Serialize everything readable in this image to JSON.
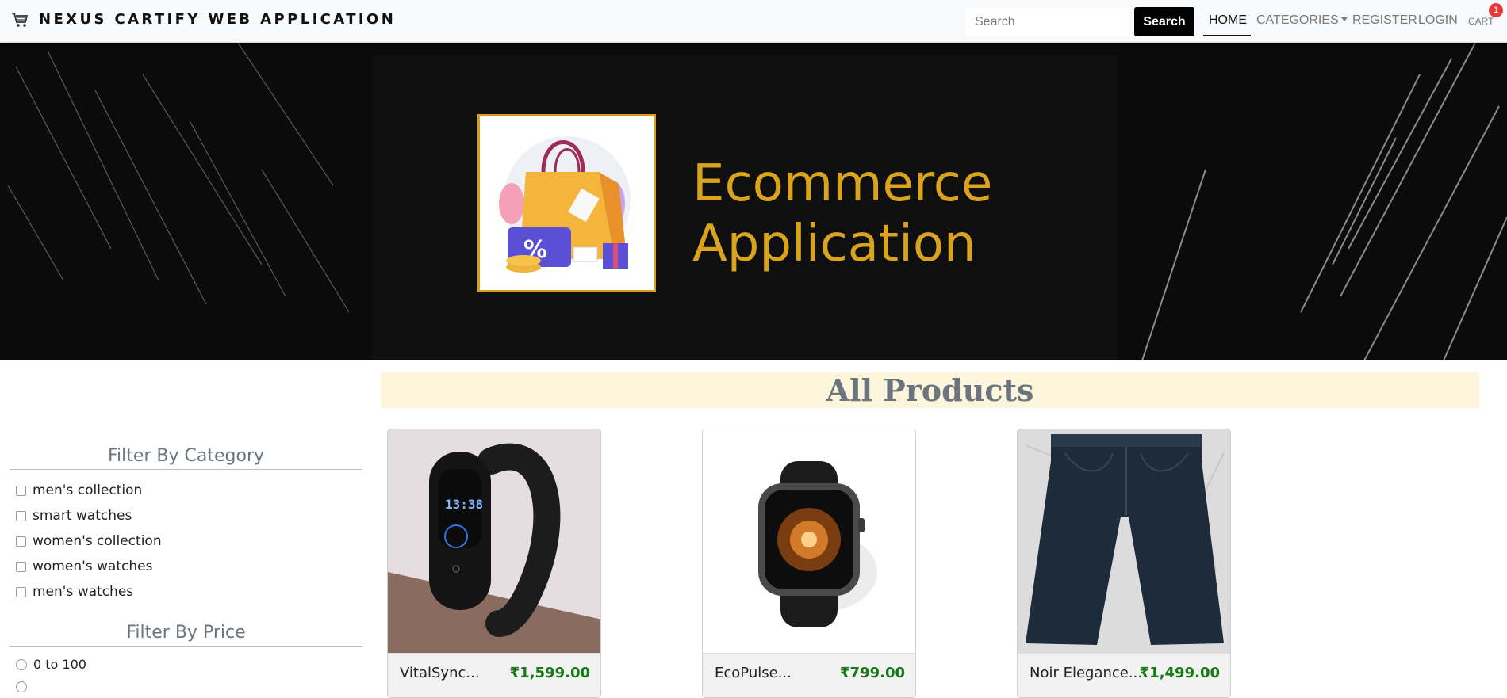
{
  "navbar": {
    "brand": "NEXUS CARTIFY WEB APPLICATION",
    "search_placeholder": "Search",
    "search_button": "Search",
    "links": {
      "home": "HOME",
      "categories": "CATEGORIES",
      "register": "REGISTER",
      "login": "LOGIN",
      "cart": "CART"
    },
    "cart_count": "1"
  },
  "banner": {
    "title_line1": "Ecommerce",
    "title_line2": "Application"
  },
  "filters": {
    "category_title": "Filter By Category",
    "categories": [
      "men's collection",
      "smart watches",
      "women's collection",
      "women's watches",
      "men's watches"
    ],
    "price_title": "Filter By Price",
    "prices": [
      "0 to 100"
    ]
  },
  "products": {
    "title": "All Products",
    "items": [
      {
        "name": "VitalSync...",
        "price": "₹1,599.00"
      },
      {
        "name": "EcoPulse...",
        "price": "₹799.00"
      },
      {
        "name": "Noir Elegance...",
        "price": "₹1,499.00"
      }
    ]
  },
  "colors": {
    "brand_accent": "#d9a31c",
    "price_green": "#157a15",
    "badge_red": "#e33b3b",
    "title_band": "#fdf6dc"
  }
}
